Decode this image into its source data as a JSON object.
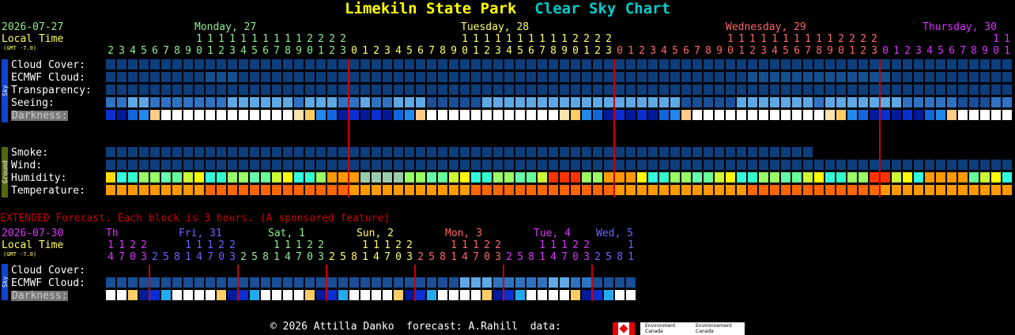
{
  "header": {
    "title_location": "Limekiln State Park",
    "title_chart": "Clear Sky Chart"
  },
  "top": {
    "date": "2026-07-27",
    "local_time": "Local Time",
    "gmt": "(GMT -7.0)",
    "days": [
      {
        "label": "Monday, 27",
        "color": "#90ee90"
      },
      {
        "label": "Tuesday, 28",
        "color": "#ffff66"
      },
      {
        "label": "Wednesday, 29",
        "color": "#ff6666"
      },
      {
        "label": "Thursday, 30",
        "color": "#dd33ff"
      }
    ],
    "hours": [
      2,
      3,
      4,
      5,
      6,
      7,
      8,
      9,
      10,
      11,
      12,
      13,
      14,
      15,
      16,
      17,
      18,
      19,
      20,
      21,
      22,
      23,
      0,
      1,
      2,
      3,
      4,
      5,
      6,
      7,
      8,
      9,
      10,
      11,
      12,
      13,
      14,
      15,
      16,
      17,
      18,
      19,
      20,
      21,
      22,
      23,
      0,
      1,
      2,
      3,
      4,
      5,
      6,
      7,
      8,
      9,
      10,
      11,
      12,
      13,
      14,
      15,
      16,
      17,
      18,
      19,
      20,
      21,
      22,
      23,
      0,
      1,
      2,
      3,
      4,
      5,
      6,
      7,
      8,
      9,
      10,
      11
    ],
    "sky_labels": [
      "Cloud Cover:",
      "ECMWF Cloud:",
      "Transparency:",
      "Seeing:",
      "Darkness:"
    ],
    "ground_labels": [
      "Smoke:",
      "Wind:",
      "Humidity:",
      "Temperature:"
    ],
    "sky_side": "Sky",
    "ground_side": "Ground"
  },
  "extended": {
    "heading": "EXTENDED Forecast. Each block is 3 hours. (A sponsored feature)",
    "date": "2026-07-30",
    "local_time": "Local Time",
    "gmt": "(GMT -7.0)",
    "days": [
      {
        "label": "Th",
        "color": "#dd33ff"
      },
      {
        "label": "Fri, 31",
        "color": "#6666ff"
      },
      {
        "label": "Sat, 1",
        "color": "#90ee90"
      },
      {
        "label": "Sun, 2",
        "color": "#ffff66"
      },
      {
        "label": "Mon, 3",
        "color": "#ff6666"
      },
      {
        "label": "Tue, 4",
        "color": "#dd33ff"
      },
      {
        "label": "Wed, 5",
        "color": "#6666ff"
      }
    ],
    "hours": [
      14,
      17,
      20,
      23,
      2,
      5,
      8,
      11,
      14,
      17,
      20,
      23,
      2,
      5,
      8,
      11,
      14,
      17,
      20,
      23,
      2,
      5,
      8,
      11,
      14,
      17,
      20,
      23,
      2,
      5,
      8,
      11,
      14,
      17,
      20,
      23,
      2,
      5,
      8,
      11,
      14,
      17,
      20,
      23,
      2,
      5,
      8,
      11
    ],
    "labels": [
      "Cloud Cover:",
      "ECMWF Cloud:",
      "Darkness:"
    ],
    "side": "Sky"
  },
  "footer": {
    "copyright": "© 2026 Attilla Danko  forecast: A.Rahill  data:",
    "logo_text_1": "Environment Canada",
    "logo_text_2": "Environnement Canada"
  },
  "colors": {
    "cloud_clear": "#0d3d7a",
    "cloud_mid": "#1f5ea8",
    "seeing_good": "#5fa8e6",
    "humidity_cyan": "#33ffdd",
    "temp_orange": "#ff6600",
    "day_white": "#ffffff",
    "night_blue": "#003399",
    "divider_red": "#cc0000"
  }
}
